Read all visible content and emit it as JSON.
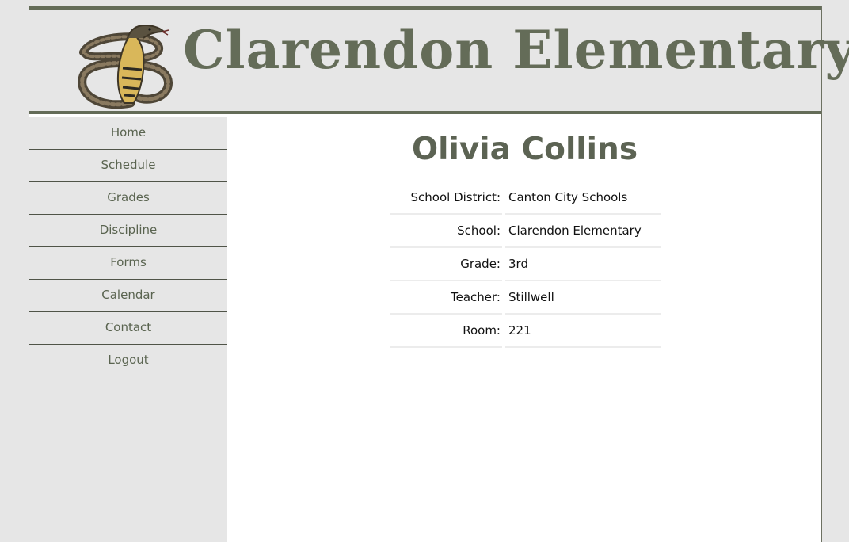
{
  "header": {
    "title": "Clarendon Elementary",
    "logo_icon": "cobra-snake-icon"
  },
  "colors": {
    "accent": "#646c58",
    "sidebar_bg": "#e6e6e6",
    "page_bg": "#e6e6e6"
  },
  "sidebar": {
    "items": [
      {
        "label": "Home"
      },
      {
        "label": "Schedule"
      },
      {
        "label": "Grades"
      },
      {
        "label": "Discipline"
      },
      {
        "label": "Forms"
      },
      {
        "label": "Calendar"
      },
      {
        "label": "Contact"
      },
      {
        "label": "Logout"
      }
    ]
  },
  "student": {
    "name": "Olivia Collins",
    "details": [
      {
        "label": "School District:",
        "value": "Canton City Schools"
      },
      {
        "label": "School:",
        "value": "Clarendon Elementary"
      },
      {
        "label": "Grade:",
        "value": "3rd"
      },
      {
        "label": "Teacher:",
        "value": "Stillwell"
      },
      {
        "label": "Room:",
        "value": "221"
      }
    ]
  }
}
